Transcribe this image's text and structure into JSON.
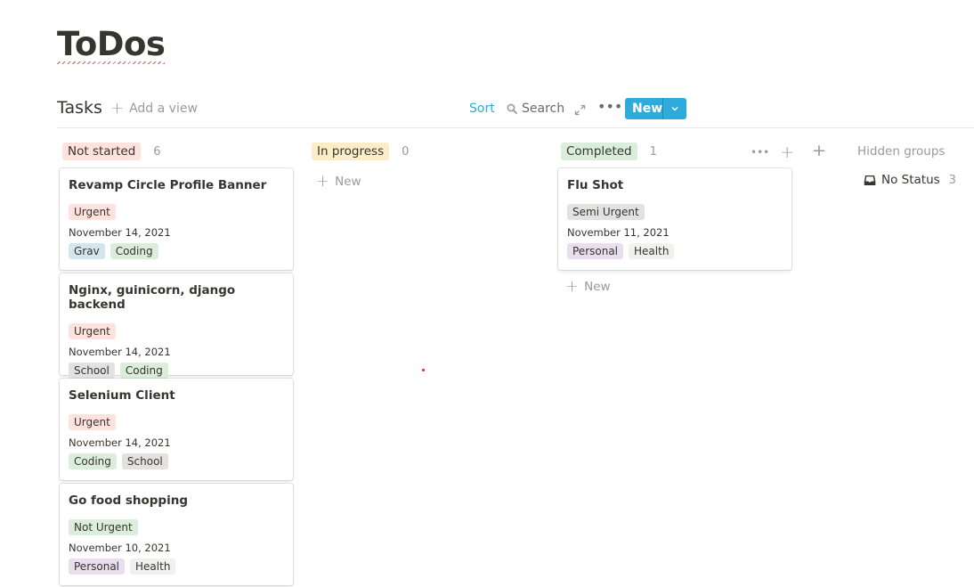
{
  "page": {
    "title": "ToDos"
  },
  "toolbar": {
    "view_name": "Tasks",
    "add_view_label": "Add a view",
    "sort_label": "Sort",
    "search_label": "Search",
    "new_label": "New"
  },
  "groups": [
    {
      "name": "Not started",
      "count": "6",
      "color": "#ffe2dd"
    },
    {
      "name": "In progress",
      "count": "0",
      "color": "#fdecc8",
      "new_label": "New"
    },
    {
      "name": "Completed",
      "count": "1",
      "color": "#dbeddb",
      "new_label": "New"
    }
  ],
  "cards": [
    {
      "title": "Revamp Circle Profile Banner",
      "priority": "Urgent",
      "date": "November 14, 2021",
      "tags": [
        "Grav",
        "Coding"
      ]
    },
    {
      "title": "Nginx, guinicorn, django backend",
      "priority": "Urgent",
      "date": "November 14, 2021",
      "tags": [
        "School",
        "Coding"
      ]
    },
    {
      "title": "Selenium Client",
      "priority": "Urgent",
      "date": "November 14, 2021",
      "tags": [
        "Coding",
        "School"
      ]
    },
    {
      "title": "Go food shopping",
      "priority": "Not Urgent",
      "date": "November 10, 2021",
      "tags": [
        "Personal",
        "Health"
      ]
    },
    {
      "title": "Flu Shot",
      "priority": "Semi Urgent",
      "date": "November 11, 2021",
      "tags": [
        "Personal",
        "Health"
      ]
    }
  ],
  "hidden_groups": {
    "label": "Hidden groups",
    "items": [
      {
        "name": "No Status",
        "count": "3"
      }
    ]
  },
  "colors": {
    "accent": "#2eaadc"
  }
}
